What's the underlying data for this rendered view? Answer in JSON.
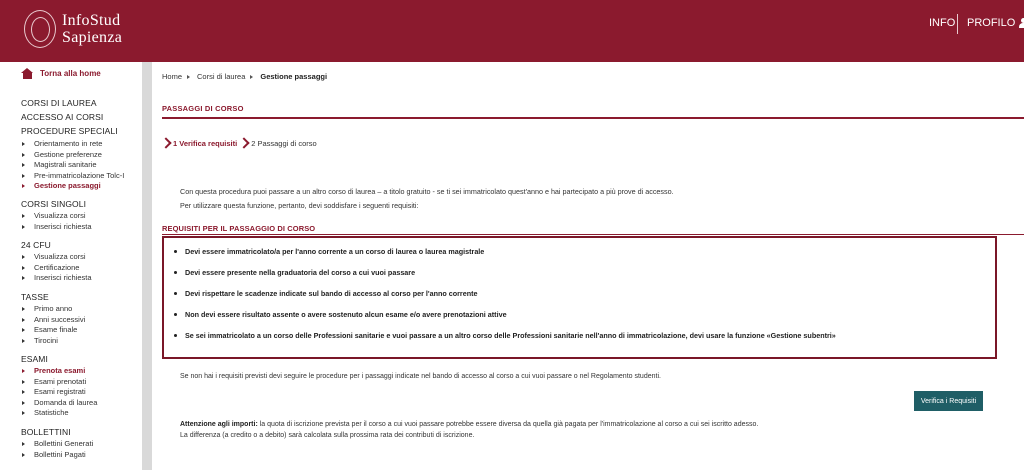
{
  "header": {
    "logo_line1": "InfoStud",
    "logo_line2": "Sapienza",
    "nav_info": "INFO",
    "nav_profilo": "PROFILO"
  },
  "sidebar": {
    "home_label": "Torna alla home",
    "sections": [
      {
        "title": "CORSI DI LAUREA",
        "items": []
      },
      {
        "title": "ACCESSO AI CORSI",
        "items": []
      },
      {
        "title": "PROCEDURE SPECIALI",
        "items": [
          "Orientamento in rete",
          "Gestione preferenze",
          "Magistrali sanitarie",
          "Pre-immatricolazione Tolc-I",
          "Gestione passaggi"
        ]
      },
      {
        "title": "CORSI SINGOLI",
        "items": [
          "Visualizza corsi",
          "Inserisci richiesta"
        ]
      },
      {
        "title": "24 CFU",
        "items": [
          "Visualizza corsi",
          "Certificazione",
          "Inserisci richiesta"
        ]
      },
      {
        "title": "TASSE",
        "items": [
          "Primo anno",
          "Anni successivi",
          "Esame finale",
          "Tirocini"
        ]
      },
      {
        "title": "ESAMI",
        "items": [
          "Prenota esami",
          "Esami prenotati",
          "Esami registrati",
          "Domanda di laurea",
          "Statistiche"
        ]
      },
      {
        "title": "BOLLETTINI",
        "items": [
          "Bollettini Generati",
          "Bollettini Pagati"
        ]
      }
    ]
  },
  "breadcrumb": [
    "Home",
    "Corsi di laurea",
    "Gestione passaggi"
  ],
  "page_title": "PASSAGGI DI CORSO",
  "steps": [
    "1 Verifica requisiti",
    "2 Passaggi di corso"
  ],
  "intro": [
    "Con questa procedura puoi passare a un altro corso di laurea – a titolo gratuito - se ti sei immatricolato quest'anno e hai partecipato a più prove di accesso.",
    "Per utilizzare questa funzione, pertanto, devi soddisfare i seguenti requisiti:"
  ],
  "requirements_title": "REQUISITI PER IL PASSAGGIO DI CORSO",
  "requirements": [
    "Devi essere immatricolato/a per l'anno corrente a un corso di laurea o laurea magistrale",
    "Devi essere presente nella graduatoria del corso a cui vuoi passare",
    "Devi rispettare le scadenze indicate sul bando di accesso al corso per l'anno corrente",
    "Non devi essere risultato assente o avere sostenuto alcun esame e/o avere prenotazioni attive",
    "Se sei immatricolato a un corso delle Professioni sanitarie e vuoi passare a un altro corso delle Professioni sanitarie nell'anno di immatricolazione, devi usare la funzione «Gestione subentri»"
  ],
  "note": "Se non hai i requisiti previsti devi seguire le procedure per i passaggi indicate nel bando di accesso al corso a cui vuoi passare o nel Regolamento studenti.",
  "verify_button": "Verifica i Requisiti",
  "warning": {
    "bold": "Attenzione agli importi:",
    "line1": " la quota di iscrizione prevista per il corso a cui vuoi passare potrebbe essere diversa da quella già pagata per l'immatricolazione al corso a cui sei iscritto adesso.",
    "line2": "La differenza (a credito o a debito) sarà calcolata sulla prossima rata dei contributi di iscrizione."
  },
  "colors": {
    "brand": "#8b1a2e",
    "button": "#1f5e66"
  }
}
